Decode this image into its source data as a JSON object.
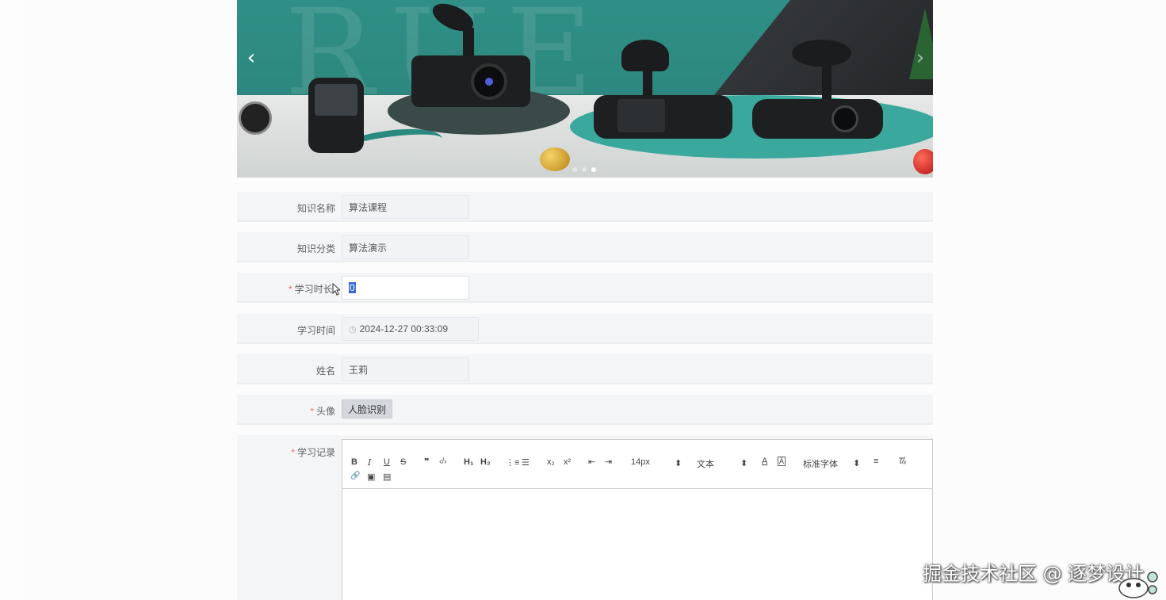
{
  "banner": {
    "prev_icon": "‹",
    "next_icon": "›",
    "slide_count": 3,
    "active_slide": 3
  },
  "form": {
    "name": {
      "label": "知识名称",
      "value": "算法课程"
    },
    "category": {
      "label": "知识分类",
      "value": "算法演示"
    },
    "duration": {
      "required_mark": "*",
      "label": "学习时长/",
      "value": "0"
    },
    "study_time": {
      "label": "学习时间",
      "value": "2024-12-27 00:33:09",
      "icon": "clock-icon"
    },
    "user": {
      "label": "姓名",
      "value": "王莉"
    },
    "avatar": {
      "required_mark": "*",
      "label": "头像",
      "button": "人脸识别"
    },
    "record": {
      "required_mark": "*",
      "label": "学习记录"
    }
  },
  "editor": {
    "toolbar": {
      "bold": "B",
      "italic": "I",
      "underline": "U",
      "strike": "S",
      "quote": "❞",
      "code": "‹/›",
      "h1": "H₁",
      "h2": "H₂",
      "ordered_list": "⋮≡",
      "bullet_list": "☰",
      "sub": "x₂",
      "sup": "x²",
      "outdent": "⇤",
      "indent": "⇥",
      "size": "14px",
      "header": "文本",
      "color": "A",
      "background": "Ā",
      "font": "标准字体",
      "align": "≡",
      "clean": "T̸ₓ",
      "link": "🔗",
      "image": "▣",
      "video": "▤",
      "dropdown_arrow": "⬍"
    }
  },
  "watermark": "掘金技术社区 @ 逐梦设计",
  "colors": {
    "required": "#f56c6c",
    "selection": "#3a6bd6",
    "banner_teal": "#2f8f86"
  }
}
